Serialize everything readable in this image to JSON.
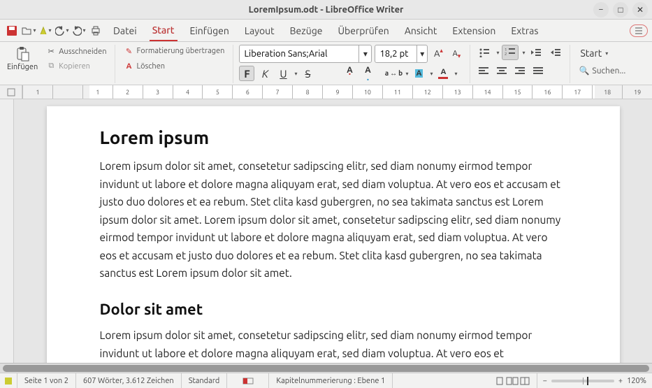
{
  "window": {
    "title": "LoremIpsum.odt - LibreOffice Writer"
  },
  "menus": {
    "datei": "Datei",
    "start": "Start",
    "einfuegen": "Einfügen",
    "layout": "Layout",
    "bezuege": "Bezüge",
    "ueberpruefen": "Überprüfen",
    "ansicht": "Ansicht",
    "extension": "Extension",
    "extras": "Extras"
  },
  "ribbon": {
    "paste": "Einfügen",
    "cut": "Ausschneiden",
    "copy": "Kopieren",
    "format_paint": "Formatierung übertragen",
    "clear_format": "Löschen",
    "font_name": "Liberation Sans;Arial",
    "font_size": "18,2 pt",
    "start_style": "Start",
    "search": "Suchen..."
  },
  "ruler": {
    "numbers": [
      "1",
      "",
      "1",
      "2",
      "3",
      "4",
      "5",
      "6",
      "7",
      "8",
      "9",
      "10",
      "11",
      "12",
      "13",
      "14",
      "15",
      "16",
      "17",
      "18",
      "19"
    ]
  },
  "document": {
    "h1": "Lorem ipsum",
    "p1": "Lorem ipsum dolor sit amet, consetetur sadipscing elitr, sed diam nonumy eirmod tempor invidunt ut labore et dolore magna aliquyam erat, sed diam voluptua. At vero eos et accusam et justo duo dolores et ea rebum. Stet clita kasd gubergren, no sea takimata sanctus est Lorem ipsum dolor sit amet. Lorem ipsum dolor sit amet, consetetur sadipscing elitr, sed diam nonumy eirmod tempor invidunt ut labore et dolore magna aliquyam erat, sed diam voluptua. At vero eos et accusam et justo duo dolores et ea rebum. Stet clita kasd gubergren, no sea takimata sanctus est Lorem ipsum dolor sit amet.",
    "h2": "Dolor sit amet",
    "p2": "Lorem ipsum dolor sit amet, consetetur sadipscing elitr, sed diam nonumy eirmod tempor invidunt ut labore et dolore magna aliquyam erat, sed diam voluptua. At vero eos et"
  },
  "status": {
    "page": "Seite 1 von 2",
    "words": "607 Wörter, 3.612 Zeichen",
    "style": "Standard",
    "lang": "",
    "insert": "",
    "outline": "Kapitelnummerierung : Ebene 1",
    "zoom_minus": "−",
    "zoom_plus": "+",
    "zoom_pct": "120%"
  }
}
